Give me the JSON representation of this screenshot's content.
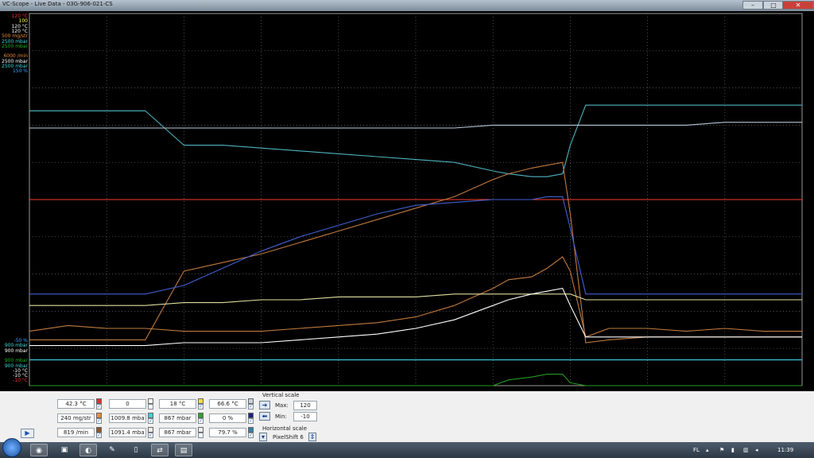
{
  "window": {
    "title": "VC-Scope - Live Data - 03G-906-021-CS",
    "minimize_icon": "minimize-icon",
    "maximize_icon": "maximize-icon",
    "close_icon": "close-icon"
  },
  "scope": {
    "top_scales": [
      {
        "text": "120 °C",
        "color": "#ff3030"
      },
      {
        "text": "100",
        "color": "#ffff50"
      },
      {
        "text": "120 °C",
        "color": "#ffffff"
      },
      {
        "text": "120 °C",
        "color": "#ffffff"
      },
      {
        "text": "500 mg/str",
        "color": "#e08a3a"
      },
      {
        "text": "2500 mbar",
        "color": "#40d8d8"
      },
      {
        "text": "2500 mbar",
        "color": "#20b020"
      },
      {
        "text": "",
        "color": "#000000"
      },
      {
        "text": "6000 /min",
        "color": "#e08a3a"
      },
      {
        "text": "2500 mbar",
        "color": "#ffffff"
      },
      {
        "text": "2500 mbar",
        "color": "#40d8d8"
      },
      {
        "text": "150 %",
        "color": "#40a0ff"
      }
    ],
    "bottom_scales": [
      {
        "text": "-50 %",
        "color": "#40a0ff"
      },
      {
        "text": "900 mbar",
        "color": "#40d8d8"
      },
      {
        "text": "900 mbar",
        "color": "#ffffff"
      },
      {
        "text": "",
        "color": "#000000"
      },
      {
        "text": "900 mbar",
        "color": "#20b020"
      },
      {
        "text": "900 mbar",
        "color": "#40d8d8"
      },
      {
        "text": "-10 °C",
        "color": "#ffffff"
      },
      {
        "text": "-10 °C",
        "color": "#ffffff"
      },
      {
        "text": "-10 °C",
        "color": "#ff3030"
      }
    ]
  },
  "chart_data": {
    "type": "line",
    "title": "",
    "xlabel": "",
    "ylabel": "",
    "ylim": [
      -10,
      120
    ],
    "x": [
      0,
      5,
      10,
      15,
      20,
      25,
      30,
      35,
      40,
      45,
      50,
      55,
      60,
      62,
      65,
      67,
      69,
      70,
      72,
      75,
      80,
      85,
      90,
      95,
      100
    ],
    "series": [
      {
        "color": "#4fb3bf",
        "values": [
          86,
          86,
          86,
          86,
          74,
          74,
          73,
          72,
          71,
          70,
          69,
          68,
          65,
          64,
          63,
          63,
          64,
          74,
          88,
          88,
          88,
          88,
          88,
          88,
          88
        ]
      },
      {
        "color": "#b8c8d8",
        "values": [
          80,
          80,
          80,
          80,
          80,
          80,
          80,
          80,
          80,
          80,
          80,
          80,
          81,
          81,
          81,
          81,
          81,
          81,
          81,
          81,
          81,
          81,
          82,
          82,
          82
        ]
      },
      {
        "color": "#ff3a30",
        "values": [
          55,
          55,
          55,
          55,
          55,
          55,
          55,
          55,
          55,
          55,
          55,
          55,
          55,
          55,
          55,
          55,
          55,
          55,
          55,
          55,
          55,
          55,
          55,
          55,
          55
        ]
      },
      {
        "color": "#c07a40",
        "values": [
          6,
          6,
          6,
          6,
          30,
          33,
          36,
          40,
          44,
          48,
          52,
          56,
          62,
          64,
          66,
          67,
          68,
          50,
          5,
          6,
          7,
          7,
          7,
          7,
          7
        ]
      },
      {
        "color": "#c07a40",
        "values": [
          9,
          11,
          10,
          10,
          9,
          9,
          9,
          10,
          11,
          12,
          14,
          18,
          24,
          27,
          28,
          31,
          35,
          30,
          7,
          10,
          10,
          9,
          10,
          9,
          9
        ]
      },
      {
        "color": "#e0e0a0",
        "values": [
          18,
          18,
          18,
          18,
          19,
          19,
          20,
          20,
          21,
          21,
          21,
          22,
          22,
          22,
          22,
          22,
          22,
          22,
          20,
          20,
          20,
          20,
          20,
          20,
          20
        ]
      },
      {
        "color": "#ffffff",
        "values": [
          4,
          4,
          4,
          4,
          5,
          5,
          5,
          6,
          7,
          8,
          10,
          13,
          18,
          20,
          22,
          23,
          24,
          18,
          7,
          7,
          7,
          7,
          7,
          7,
          7
        ]
      },
      {
        "color": "#4060d0",
        "values": [
          22,
          22,
          22,
          22,
          25,
          31,
          37,
          42,
          46,
          50,
          53,
          54,
          55,
          55,
          55,
          56,
          56,
          45,
          22,
          22,
          22,
          22,
          22,
          22,
          22
        ]
      },
      {
        "color": "#40d0e0",
        "values": [
          -1,
          -1,
          -1,
          -1,
          -1,
          -1,
          -1,
          -1,
          -1,
          -1,
          -1,
          -1,
          -1,
          -1,
          -1,
          -1,
          -1,
          -1,
          -1,
          -1,
          -1,
          -1,
          -1,
          -1,
          -1
        ]
      },
      {
        "color": "#1f9a1f",
        "values": [
          -10,
          -10,
          -10,
          -10,
          -10,
          -10,
          -10,
          -10,
          -10,
          -10,
          -10,
          -10,
          -10,
          -8,
          -7,
          -6,
          -6,
          -9,
          -10,
          -10,
          -10,
          -10,
          -10,
          -10,
          -10
        ]
      }
    ]
  },
  "controls": {
    "rows": [
      [
        {
          "value": "42.3 °C",
          "swatch": "#e03030",
          "checked": true
        },
        {
          "value": "0",
          "swatch": "#ffffff",
          "checked": false
        },
        {
          "value": "18 °C",
          "swatch": "#f0e040",
          "checked": true
        },
        {
          "value": "66.6 °C",
          "swatch": "#c8d0e0",
          "checked": true
        }
      ],
      [
        {
          "value": "240 mg/str",
          "swatch": "#e0903a",
          "checked": true
        },
        {
          "value": "1009.8 mba",
          "swatch": "#40d0d8",
          "checked": true
        },
        {
          "value": "867 mbar",
          "swatch": "#30a030",
          "checked": true
        },
        {
          "value": "0 %",
          "swatch": "#202080",
          "checked": true
        }
      ],
      [
        {
          "value": "819 /min",
          "swatch": "#8a5a30",
          "checked": true
        },
        {
          "value": "1091.4 mba",
          "swatch": "#f0f0f0",
          "checked": true
        },
        {
          "value": "867 mbar",
          "swatch": "#f0f0f0",
          "checked": false
        },
        {
          "value": "79.7 %",
          "swatch": "#3080a0",
          "checked": true
        }
      ]
    ],
    "vertical_scale": {
      "heading": "Vertical scale",
      "max_label": "Max:",
      "max_value": "120",
      "min_label": "Min:",
      "min_value": "-10"
    },
    "horizontal_scale": {
      "heading": "Horizontal scale",
      "mode_value": "PixelShift 6"
    }
  },
  "taskbar": {
    "tray_lang": "FL",
    "clock": "11:39"
  }
}
